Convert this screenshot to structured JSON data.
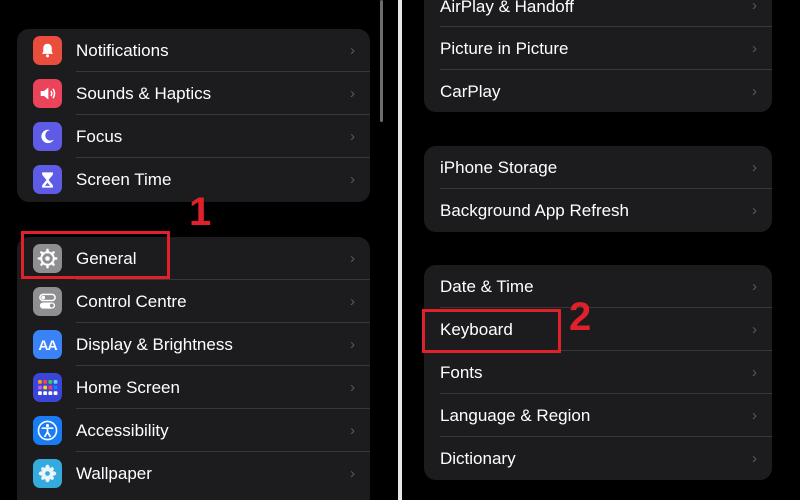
{
  "left": {
    "group1": [
      {
        "label": "Notifications",
        "icon": "bell-icon",
        "color": "#eb4d3d"
      },
      {
        "label": "Sounds & Haptics",
        "icon": "speaker-icon",
        "color": "#eb445a"
      },
      {
        "label": "Focus",
        "icon": "moon-icon",
        "color": "#5e5ce6"
      },
      {
        "label": "Screen Time",
        "icon": "hourglass-icon",
        "color": "#5e5ce6"
      }
    ],
    "group2": [
      {
        "label": "General",
        "icon": "gear-icon",
        "color": "#8e8e93"
      },
      {
        "label": "Control Centre",
        "icon": "toggles-icon",
        "color": "#8e8e93"
      },
      {
        "label": "Display & Brightness",
        "icon": "aa-icon",
        "icon_text": "AA",
        "color": "#3a82f7"
      },
      {
        "label": "Home Screen",
        "icon": "app-grid-icon",
        "color": "#3b46d9"
      },
      {
        "label": "Accessibility",
        "icon": "accessibility-icon",
        "color": "#1a7cf5"
      },
      {
        "label": "Wallpaper",
        "icon": "flower-icon",
        "color": "#35aadc"
      }
    ]
  },
  "right": {
    "group1": [
      {
        "label": "AirPlay & Handoff"
      },
      {
        "label": "Picture in Picture"
      },
      {
        "label": "CarPlay"
      }
    ],
    "group2": [
      {
        "label": "iPhone Storage"
      },
      {
        "label": "Background App Refresh"
      }
    ],
    "group3": [
      {
        "label": "Date & Time"
      },
      {
        "label": "Keyboard"
      },
      {
        "label": "Fonts"
      },
      {
        "label": "Language & Region"
      },
      {
        "label": "Dictionary"
      }
    ]
  },
  "annotations": {
    "step1": "1",
    "step2": "2",
    "color": "#e0212b"
  },
  "chevron": "›"
}
